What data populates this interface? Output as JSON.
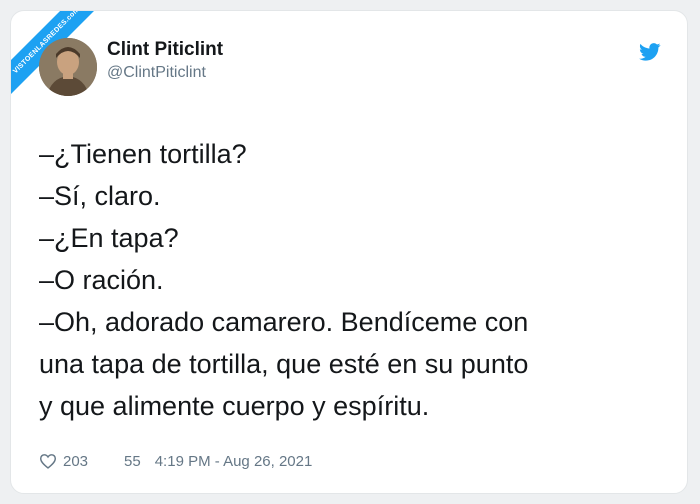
{
  "watermark": {
    "text": "VISTOENLASREDES.com"
  },
  "user": {
    "display_name": "Clint Piticlint",
    "handle": "@ClintPiticlint"
  },
  "tweet": {
    "text": "–¿Tienen tortilla?\n–Sí, claro.\n–¿En tapa?\n–O ración.\n–Oh, adorado camarero. Bendíceme con\nuna tapa de tortilla, que esté en su punto\ny que alimente cuerpo y espíritu."
  },
  "footer": {
    "likes": "203",
    "retweets": "55",
    "timestamp": "4:19 PM - Aug 26, 2021"
  },
  "icons": {
    "brand": "twitter-bird-icon",
    "like": "heart-icon"
  },
  "colors": {
    "twitter_blue": "#1da1f2",
    "text": "#14171a",
    "muted": "#657786"
  }
}
